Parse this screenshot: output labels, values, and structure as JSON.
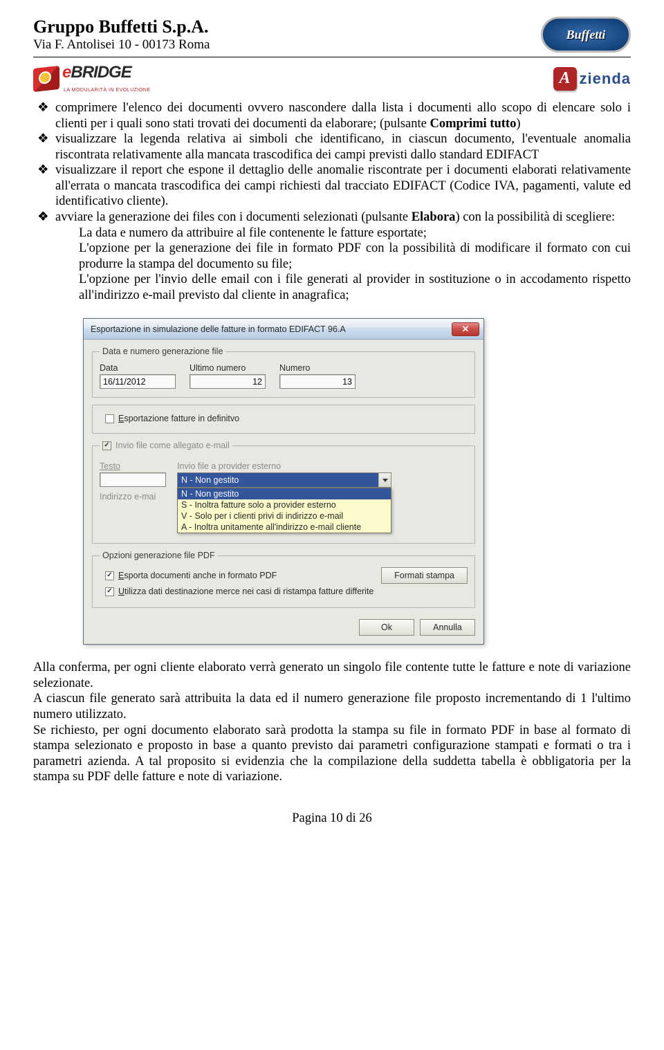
{
  "header": {
    "company": "Gruppo Buffetti S.p.A.",
    "address": "Via F. Antolisei 10 - 00173 Roma",
    "logo_text": "Buffetti"
  },
  "logos": {
    "ebridge_e": "e",
    "ebridge_rest": "BRIDGE",
    "ebridge_sub": "LA MODULARITÀ IN EVOLUZIONE",
    "azienda": "zienda"
  },
  "bullets": [
    {
      "pre": "comprimere l'elenco dei documenti ovvero nascondere dalla lista i documenti allo scopo di elencare solo i clienti per i quali sono stati trovati dei documenti da elaborare; (pulsante ",
      "bold": "Comprimi tutto",
      "post": ")"
    },
    {
      "text": "visualizzare la legenda relativa ai simboli che identificano, in ciascun documento, l'eventuale anomalia riscontrata relativamente alla mancata trascodifica dei campi previsti dallo standard EDIFACT"
    },
    {
      "text": "visualizzare il report che espone il dettaglio delle anomalie riscontrate per i documenti elaborati relativamente all'errata o mancata trascodifica dei campi richiesti dal tracciato EDIFACT (Codice IVA, pagamenti, valute ed identificativo cliente)."
    },
    {
      "pre": "avviare la generazione dei files con i documenti selezionati (pulsante ",
      "bold": "Elabora",
      "post": ") con la possibilità di scegliere:",
      "children": [
        "La data e numero da attribuire al file contenente le fatture esportate;",
        "L'opzione per la generazione dei file in formato PDF con la possibilità di modificare il formato con cui produrre la stampa del documento su file;",
        "L'opzione per l'invio delle email con i file generati al provider  in sostituzione o in accodamento rispetto all'indirizzo e-mail previsto dal cliente in anagrafica;"
      ]
    }
  ],
  "dialog": {
    "title": "Esportazione in simulazione delle fatture in formato EDIFACT 96.A",
    "group1": {
      "legend": "Data e numero generazione file",
      "data_label": "Data",
      "data_value": "16/11/2012",
      "ultimo_label": "Ultimo numero",
      "ultimo_value": "12",
      "numero_label": "Numero",
      "numero_value": "13"
    },
    "esporta_def": {
      "mn": "E",
      "rest": "sportazione fatture in definitvo"
    },
    "group_email": {
      "legend": "Invio file come allegato e-mail",
      "testo_label": "Testo",
      "indirizzo_label": "Indirizzo e-mai",
      "combo_label": "Invio file a provider esterno",
      "combo_value": "N - Non gestito",
      "options": [
        "N - Non gestito",
        "S - Inoltra fatture solo a provider esterno",
        "V - Solo per i clienti privi di indirizzo e-mail",
        "A - Inoltra unitamente all'indirizzo e-mail cliente"
      ]
    },
    "group_pdf": {
      "legend": "Opzioni generazione file PDF",
      "chk1_mn": "E",
      "chk1_rest": "sporta documenti anche in formato PDF",
      "btn_formati": "Formati stampa",
      "chk2_mn": "U",
      "chk2_rest": "tilizza dati destinazione merce nei casi di ristampa fatture differite"
    },
    "buttons": {
      "ok": "Ok",
      "cancel": "Annulla"
    }
  },
  "paragraphs": [
    "Alla conferma, per ogni cliente elaborato verrà generato un singolo file contente tutte le fatture e note di variazione selezionate.",
    "A ciascun file generato sarà attribuita la data ed il numero generazione file proposto incrementando di 1 l'ultimo numero utilizzato.",
    "Se richiesto, per ogni documento elaborato sarà prodotta la stampa su file in formato PDF in base al formato di stampa selezionato e proposto in base a quanto previsto dai parametri configurazione stampati e formati o tra i parametri azienda. A tal proposito si evidenzia che la compilazione della suddetta tabella è obbligatoria per la stampa su PDF delle fatture e note di variazione."
  ],
  "footer": "Pagina 10 di 26"
}
